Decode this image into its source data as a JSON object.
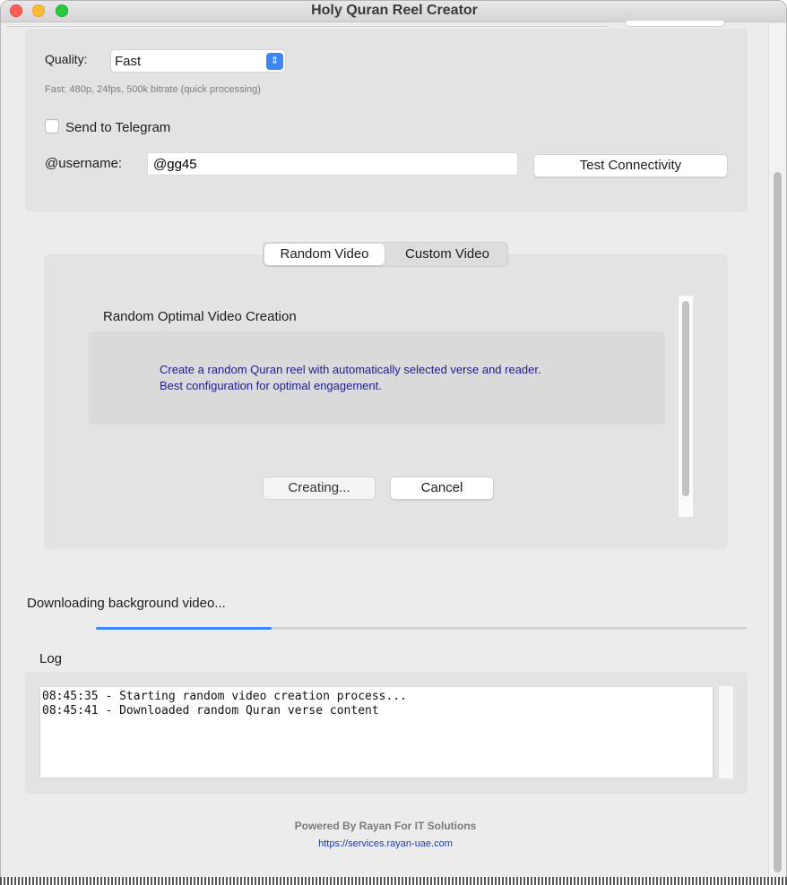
{
  "window": {
    "title": "Holy Quran Reel Creator"
  },
  "settings": {
    "quality_label": "Quality:",
    "quality_value": "Fast",
    "quality_hint": "Fast: 480p, 24fps, 500k bitrate (quick processing)",
    "telegram_label": "Send to Telegram",
    "telegram_checked": false,
    "username_label": "@username:",
    "username_value": "@gg45",
    "test_button": "Test Connectivity"
  },
  "tabs": [
    {
      "label": "Random Video",
      "active": true
    },
    {
      "label": "Custom Video",
      "active": false
    }
  ],
  "random_panel": {
    "title": "Random Optimal Video Creation",
    "description_line1": "Create a random Quran reel with automatically selected verse and reader.",
    "description_line2": "Best configuration for optimal engagement.",
    "create_button": "Creating...",
    "cancel_button": "Cancel"
  },
  "status": {
    "text": "Downloading background video...",
    "progress_fraction": 0.27
  },
  "log": {
    "label": "Log",
    "lines": [
      "08:45:35 - Starting random video creation process...",
      "08:45:41 - Downloaded random Quran verse content"
    ]
  },
  "footer": {
    "powered_by": "Powered By Rayan For IT Solutions",
    "link": "https://services.rayan-uae.com"
  },
  "colors": {
    "accent": "#3d86f4",
    "description_text": "#1c1c8a",
    "link": "#1f3bb0"
  }
}
